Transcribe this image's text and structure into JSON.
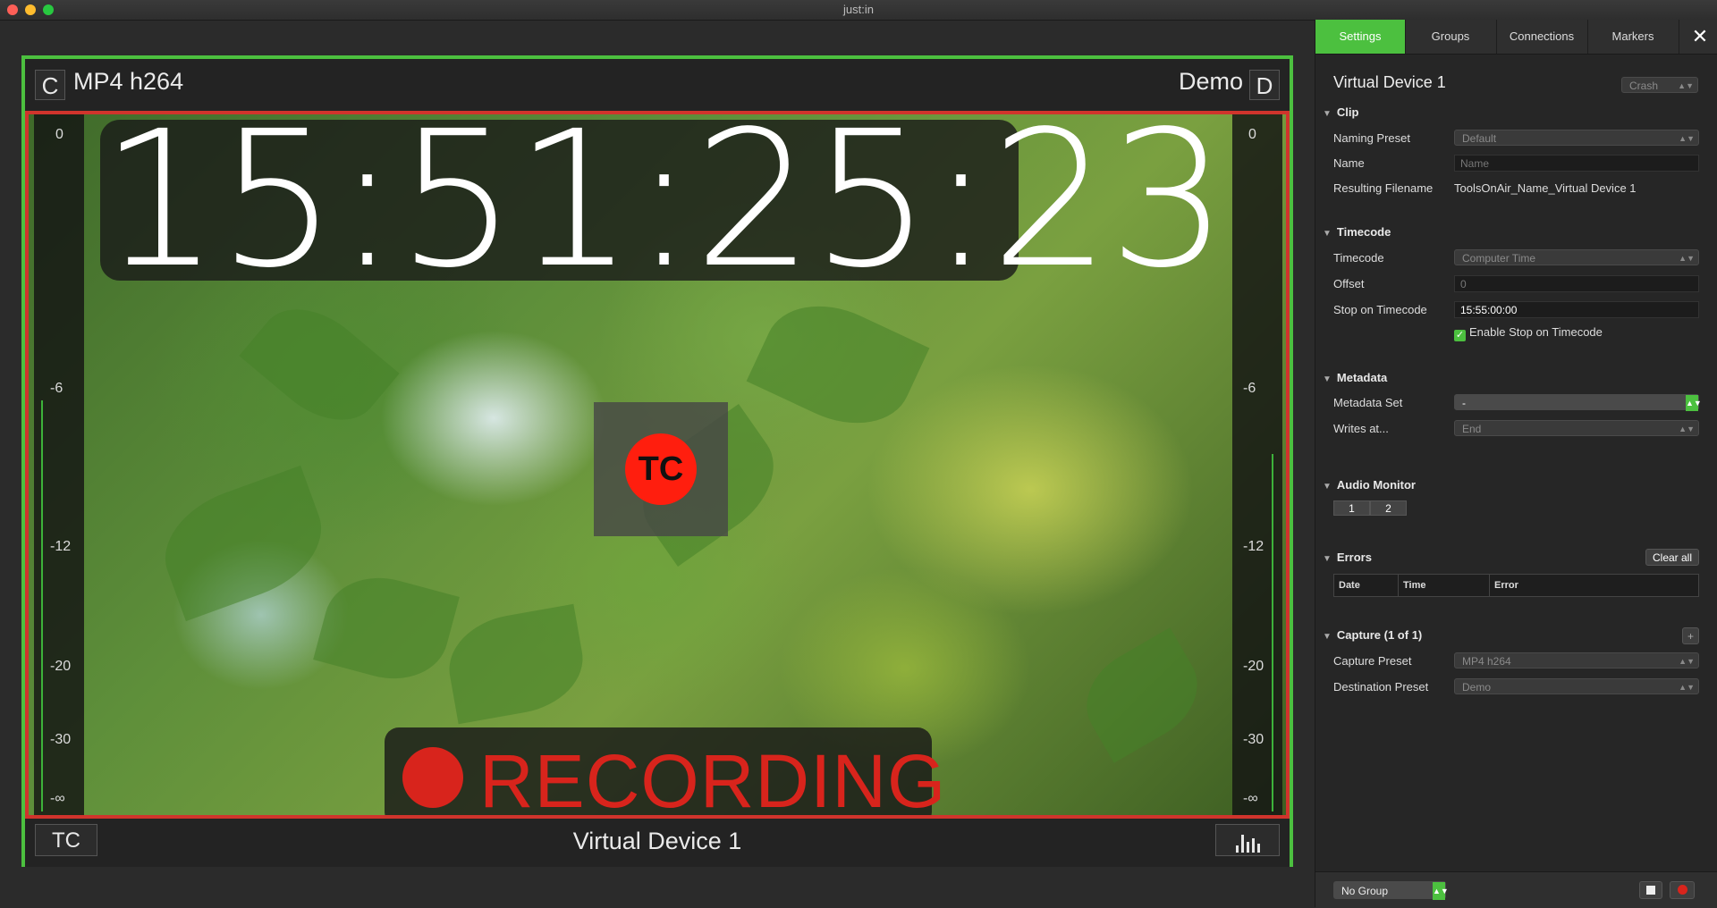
{
  "window": {
    "title": "just:in"
  },
  "viewer": {
    "left_key": "C",
    "capture_preset": "MP4 h264",
    "destination": "Demo",
    "right_key": "D",
    "timecode": "15:51:25:23",
    "tc_badge": "TC",
    "recording_label": "RECORDING",
    "footer_tc_button": "TC",
    "device_name": "Virtual Device 1",
    "meter_ticks_left": [
      "0",
      "-6",
      "-12",
      "-20",
      "-30",
      "-∞"
    ],
    "meter_ticks_right": [
      "0",
      "-6",
      "-12",
      "-20",
      "-30",
      "-∞"
    ]
  },
  "panel": {
    "tabs": [
      {
        "label": "Settings"
      },
      {
        "label": "Groups"
      },
      {
        "label": "Connections"
      },
      {
        "label": "Markers"
      }
    ],
    "close_glyph": "✕",
    "device_title": "Virtual Device 1",
    "device_status": "Crash",
    "clip": {
      "header": "Clip",
      "naming_preset_label": "Naming Preset",
      "naming_preset_value": "Default",
      "name_label": "Name",
      "name_placeholder": "Name",
      "resulting_filename_label": "Resulting Filename",
      "resulting_filename_value": "ToolsOnAir_Name_Virtual Device 1"
    },
    "timecode": {
      "header": "Timecode",
      "timecode_label": "Timecode",
      "timecode_value": "Computer Time",
      "offset_label": "Offset",
      "offset_placeholder": "0",
      "stop_label": "Stop on Timecode",
      "stop_value": "15:55:00:00",
      "enable_stop_label": "Enable Stop on Timecode"
    },
    "metadata": {
      "header": "Metadata",
      "set_label": "Metadata Set",
      "set_value": "-",
      "writes_label": "Writes at...",
      "writes_value": "End"
    },
    "audio_monitor": {
      "header": "Audio Monitor",
      "channels": [
        "1",
        "2"
      ]
    },
    "errors": {
      "header": "Errors",
      "clear_label": "Clear all",
      "columns": [
        "Date",
        "Time",
        "Error"
      ]
    },
    "capture": {
      "header": "Capture (1 of 1)",
      "add_label": "+",
      "preset_label": "Capture Preset",
      "preset_value": "MP4 h264",
      "destination_label": "Destination Preset",
      "destination_value": "Demo"
    },
    "footer": {
      "group_value": "No Group"
    }
  },
  "colors": {
    "accent_green": "#4cc03f",
    "record_red": "#d8241c",
    "tc_red": "#ff1e0e"
  }
}
